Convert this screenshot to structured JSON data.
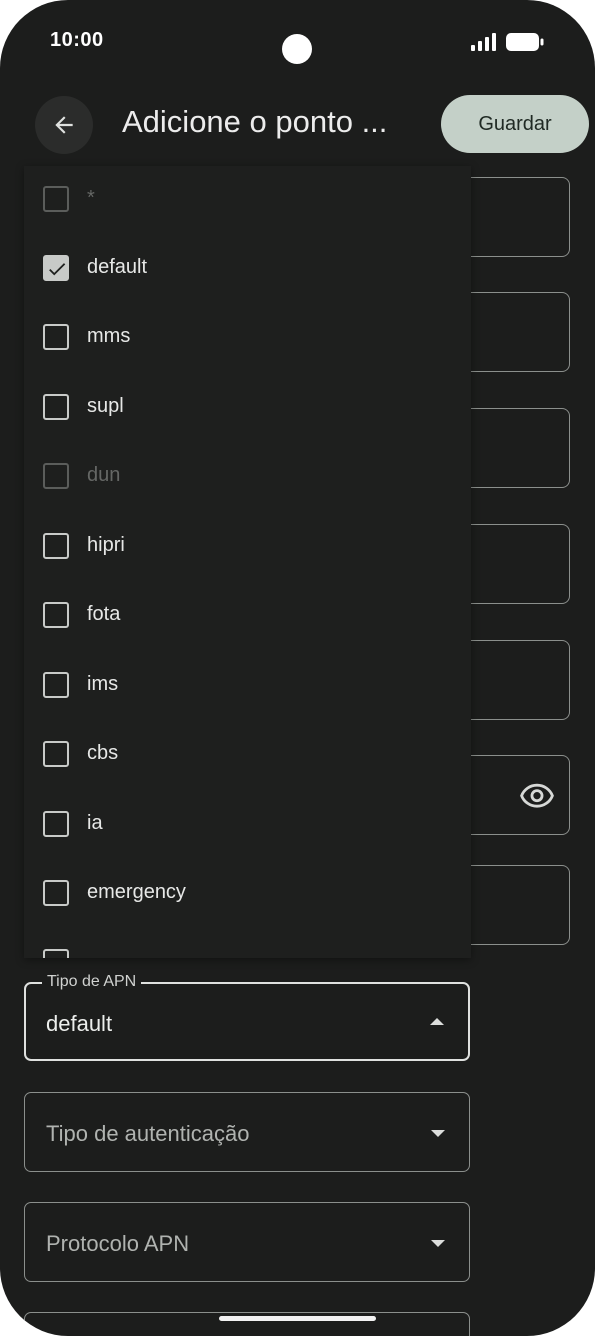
{
  "status_bar": {
    "time": "10:00"
  },
  "header": {
    "title": "Adicione o ponto ...",
    "save_label": "Guardar"
  },
  "apn_type_menu": {
    "items": [
      {
        "label": "*",
        "checked": false,
        "disabled": true
      },
      {
        "label": "default",
        "checked": true,
        "disabled": false
      },
      {
        "label": "mms",
        "checked": false,
        "disabled": false
      },
      {
        "label": "supl",
        "checked": false,
        "disabled": false
      },
      {
        "label": "dun",
        "checked": false,
        "disabled": true
      },
      {
        "label": "hipri",
        "checked": false,
        "disabled": false
      },
      {
        "label": "fota",
        "checked": false,
        "disabled": false
      },
      {
        "label": "ims",
        "checked": false,
        "disabled": false
      },
      {
        "label": "cbs",
        "checked": false,
        "disabled": false
      },
      {
        "label": "ia",
        "checked": false,
        "disabled": false
      },
      {
        "label": "emergency",
        "checked": false,
        "disabled": false
      }
    ]
  },
  "form": {
    "apn_type": {
      "label": "Tipo de APN",
      "value": "default"
    },
    "auth_type": {
      "placeholder": "Tipo de autenticação"
    },
    "apn_protocol": {
      "placeholder": "Protocolo APN"
    }
  },
  "icons": {
    "back": "arrow-back-icon",
    "check": "check-icon",
    "password_visibility": "eye-icon",
    "dropdown_open": "caret-up-icon",
    "dropdown_closed": "caret-down-icon"
  },
  "colors": {
    "background": "#1c1d1c",
    "save_button": "#c4d0c8",
    "text": "#e7e8e7",
    "outline": "#8b8f8c"
  }
}
